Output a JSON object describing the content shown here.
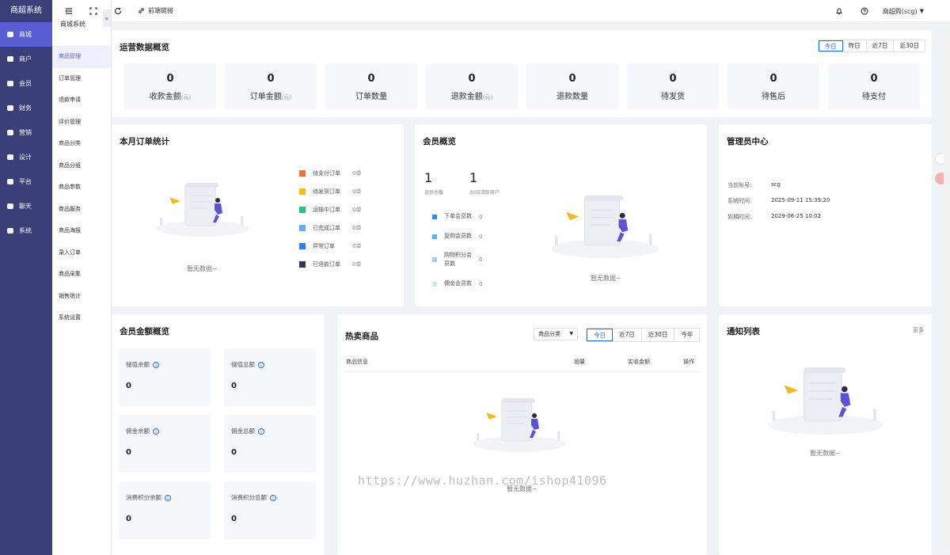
{
  "app": {
    "logo": "商超系统"
  },
  "nav": [
    {
      "label": "商城",
      "active": true
    },
    {
      "label": "商户"
    },
    {
      "label": "会员"
    },
    {
      "label": "财务"
    },
    {
      "label": "营销"
    },
    {
      "label": "设计"
    },
    {
      "label": "平台"
    },
    {
      "label": "聊天"
    },
    {
      "label": "系统"
    }
  ],
  "subnav": {
    "title": "商城系统",
    "collapse": "«",
    "items": [
      {
        "label": "商品管理",
        "active": true
      },
      {
        "label": "订单管理"
      },
      {
        "label": "退款申请"
      },
      {
        "label": "评价管理"
      },
      {
        "label": "商品分类"
      },
      {
        "label": "商品分组"
      },
      {
        "label": "商品参数"
      },
      {
        "label": "商品服务"
      },
      {
        "label": "商品海报"
      },
      {
        "label": "录入订单"
      },
      {
        "label": "商品采集"
      },
      {
        "label": "销售统计"
      },
      {
        "label": "系统设置"
      }
    ]
  },
  "topbar": {
    "link_label": "前端链接",
    "user": "商超购(scg)"
  },
  "overview": {
    "title": "运营数据概览",
    "ranges": [
      "今日",
      "昨日",
      "近7日",
      "近30日"
    ],
    "stats": [
      {
        "value": "0",
        "label": "收款金额",
        "unit": "(元)"
      },
      {
        "value": "0",
        "label": "订单金额",
        "unit": "(元)"
      },
      {
        "value": "0",
        "label": "订单数量",
        "unit": ""
      },
      {
        "value": "0",
        "label": "退款金额",
        "unit": "(元)"
      },
      {
        "value": "0",
        "label": "退款数量",
        "unit": ""
      },
      {
        "value": "0",
        "label": "待发货",
        "unit": ""
      },
      {
        "value": "0",
        "label": "待售后",
        "unit": ""
      },
      {
        "value": "0",
        "label": "待支付",
        "unit": ""
      }
    ]
  },
  "monthly": {
    "title": "本月订单统计",
    "empty": "暂无数据~",
    "legend": [
      {
        "label": "待支付订单",
        "count": "0单",
        "color": "#f07030"
      },
      {
        "label": "待发货订单",
        "count": "0单",
        "color": "#f8b820"
      },
      {
        "label": "运输中订单",
        "count": "0单",
        "color": "#30c080"
      },
      {
        "label": "已完成订单",
        "count": "0单",
        "color": "#60b0f0"
      },
      {
        "label": "异常订单",
        "count": "0单",
        "color": "#2f7ff0"
      },
      {
        "label": "已退款订单",
        "count": "0单",
        "color": "#2c3a60"
      }
    ]
  },
  "members": {
    "title": "会员概览",
    "total": "1",
    "total_label": "会员总数",
    "active": "1",
    "active_label": "30日活跃用户",
    "empty": "暂无数据~",
    "legend": [
      {
        "label": "下单会员数",
        "count": "0",
        "color": "#2a8cf0"
      },
      {
        "label": "复购会员数",
        "count": "0",
        "color": "#5eb0f5"
      },
      {
        "label": "购物积分会员数",
        "count": "0",
        "color": "#9ccdf5"
      },
      {
        "label": "佣金会员数",
        "count": "0",
        "color": "#cfe6fb"
      }
    ]
  },
  "admin": {
    "title": "管理员中心",
    "rows": [
      {
        "k": "当前账号:",
        "v": "scg"
      },
      {
        "k": "系统时间:",
        "v": "2025-09-11 15:39:20"
      },
      {
        "k": "到期时间:",
        "v": "2029-06-25 10:02"
      }
    ]
  },
  "amount": {
    "title": "会员金额概览",
    "info": "i",
    "boxes": [
      {
        "label": "储值余额",
        "value": "0"
      },
      {
        "label": "储值总额",
        "value": "0"
      },
      {
        "label": "佣金余额",
        "value": "0"
      },
      {
        "label": "佣金总额",
        "value": "0"
      },
      {
        "label": "消费积分余额",
        "value": "0"
      },
      {
        "label": "消费积分总额",
        "value": "0"
      }
    ]
  },
  "hot": {
    "title": "热卖商品",
    "category": "商品分类",
    "ranges": [
      "今日",
      "近7日",
      "近30日",
      "今年"
    ],
    "columns": [
      "商品信息",
      "销量",
      "实收金额",
      "操作"
    ],
    "empty": "暂无数据~"
  },
  "notice": {
    "title": "通知列表",
    "more": "更多",
    "empty": "暂无数据~"
  },
  "watermark": "https://www.huzhan.com/ishop41096"
}
